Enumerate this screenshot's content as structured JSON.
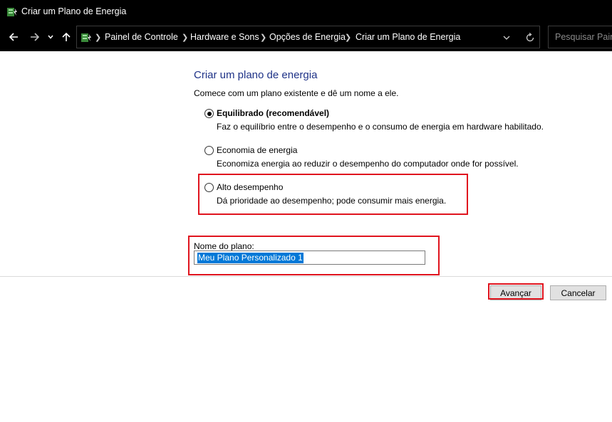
{
  "window": {
    "title": "Criar um Plano de Energia",
    "icon": "power-options-icon"
  },
  "navigation": {
    "back_icon": "arrow-left-icon",
    "forward_icon": "arrow-right-icon",
    "recent_icon": "chevron-down-icon",
    "up_icon": "arrow-up-icon",
    "breadcrumbs": [
      "Painel de Controle",
      "Hardware e Sons",
      "Opções de Energia",
      "Criar um Plano de Energia"
    ],
    "search_placeholder": "Pesquisar Painel"
  },
  "main": {
    "heading": "Criar um plano de energia",
    "intro": "Comece com um plano existente e dê um nome a ele.",
    "options": [
      {
        "label": "Equilibrado (recomendável)",
        "description": "Faz o equilíbrio entre o desempenho e o consumo de energia em hardware habilitado.",
        "selected": true
      },
      {
        "label": "Economia de energia",
        "description": "Economiza energia ao reduzir o desempenho do computador onde for possível.",
        "selected": false
      },
      {
        "label": "Alto desempenho",
        "description": "Dá prioridade ao desempenho; pode consumir mais energia.",
        "selected": false
      }
    ],
    "plan_name_label": "Nome do plano:",
    "plan_name_value": "Meu Plano Personalizado 1"
  },
  "buttons": {
    "next": "Avançar",
    "cancel": "Cancelar"
  },
  "colors": {
    "titlebar": "#000000",
    "heading": "#1e3287",
    "highlight": "#e0141e",
    "selection": "#0078d7"
  }
}
